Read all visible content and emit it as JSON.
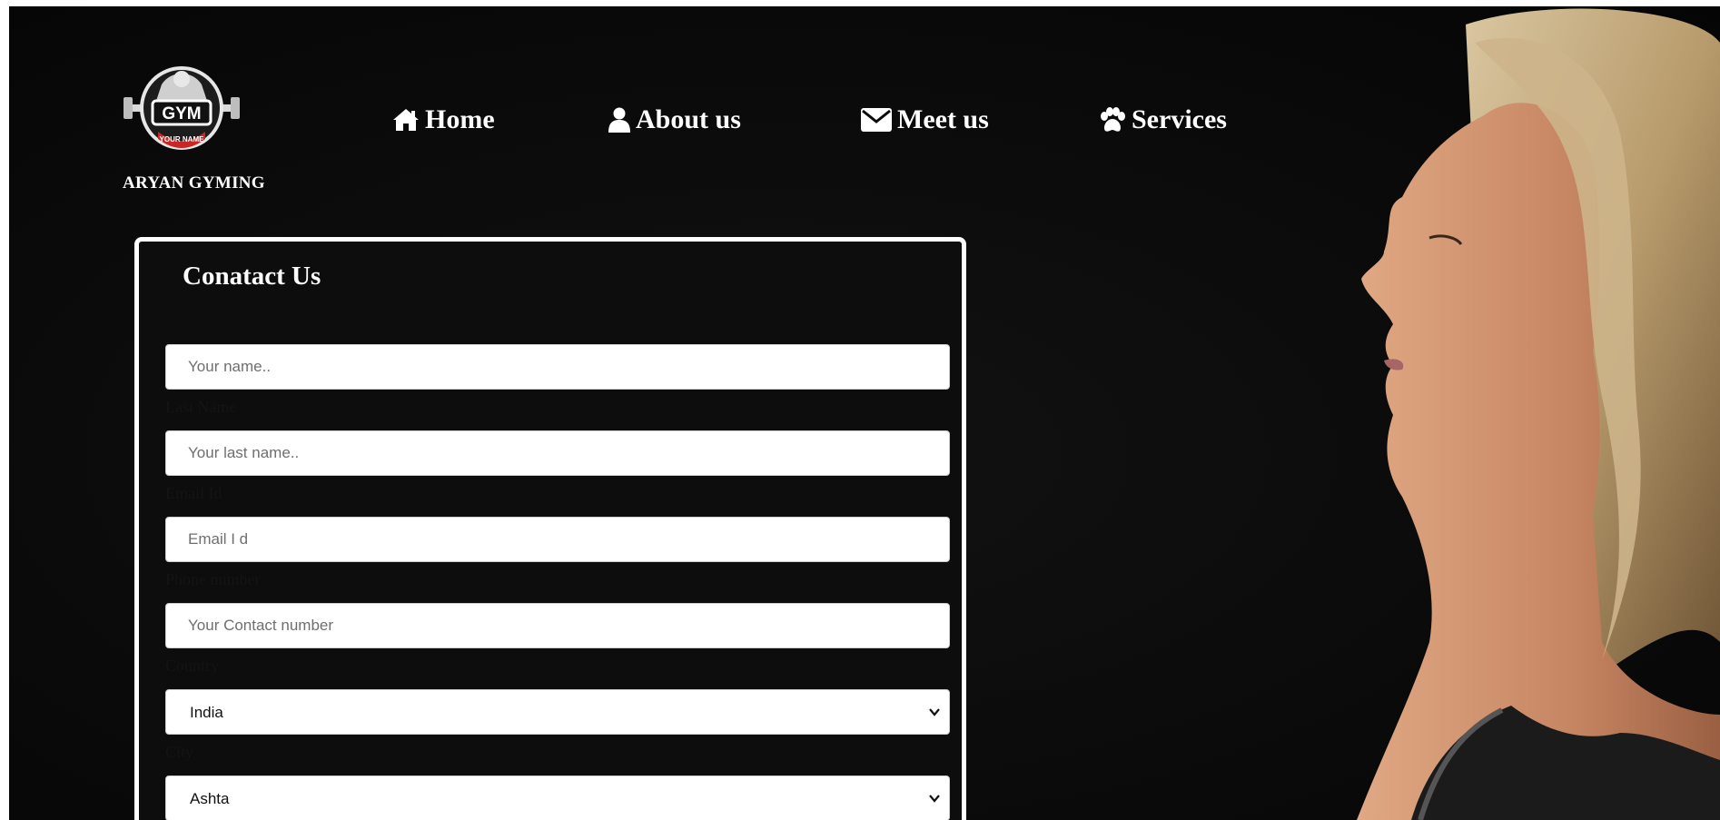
{
  "brand": {
    "logo_badge": "GYM",
    "logo_ribbon": "YOUR NAME",
    "name": "ARYAN GYMING"
  },
  "nav": {
    "items": [
      {
        "label": "Home",
        "icon": "home-icon"
      },
      {
        "label": "About us",
        "icon": "user-icon"
      },
      {
        "label": "Meet us",
        "icon": "envelope-icon"
      },
      {
        "label": "Services",
        "icon": "paw-icon"
      }
    ]
  },
  "contact": {
    "title": "Conatact Us",
    "first_name": {
      "placeholder": "Your name..",
      "value": ""
    },
    "last_name": {
      "label": "Last Name",
      "placeholder": "Your last name..",
      "value": ""
    },
    "email": {
      "label": "Email Id",
      "placeholder": "Email I d",
      "value": ""
    },
    "phone": {
      "label": "Phone number",
      "placeholder": "Your Contact number",
      "value": ""
    },
    "country": {
      "label": "Country",
      "selected": "India"
    },
    "city": {
      "label": "City",
      "selected": "Ashta"
    }
  }
}
